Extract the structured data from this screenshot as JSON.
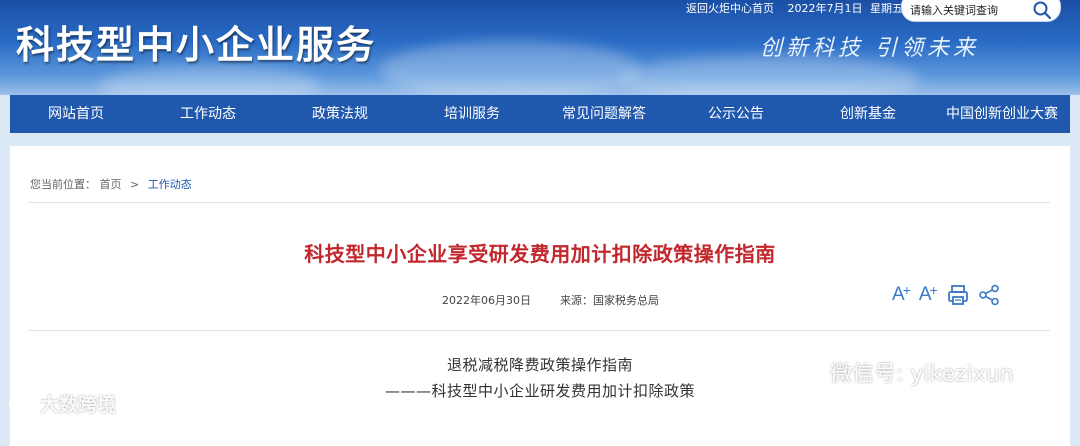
{
  "header": {
    "site_title": "科技型中小企业服务",
    "slogan": "创新科技 引领未来",
    "top_links": {
      "back_link": "返回火炬中心首页",
      "date": "2022年7月1日",
      "weekday": "星期五"
    },
    "search": {
      "placeholder": "请输入关键词查询"
    }
  },
  "nav": {
    "items": [
      {
        "label": "网站首页"
      },
      {
        "label": "工作动态"
      },
      {
        "label": "政策法规"
      },
      {
        "label": "培训服务"
      },
      {
        "label": "常见问题解答"
      },
      {
        "label": "公示公告"
      },
      {
        "label": "创新基金"
      },
      {
        "label": "中国创新创业大赛"
      }
    ]
  },
  "breadcrumb": {
    "prefix": "您当前位置：",
    "home": "首页",
    "separator": ">",
    "current": "工作动态"
  },
  "article": {
    "title": "科技型中小企业享受研发费用加计扣除政策操作指南",
    "date": "2022年06月30日",
    "source": "来源：国家税务总局",
    "tools": {
      "font_larger": "A",
      "font_smaller": "A",
      "print": "print-icon",
      "share": "share-icon"
    },
    "body_line_1": "退税减税降费政策操作指南",
    "body_line_2": "———科技型中小企业研发费用加计扣除政策"
  },
  "watermarks": {
    "left": "大数跨境",
    "right": "微信号: yikezixun"
  },
  "colors": {
    "nav_bg": "#1f58ad",
    "title_red": "#c1272d",
    "link_blue": "#1f58ad"
  }
}
